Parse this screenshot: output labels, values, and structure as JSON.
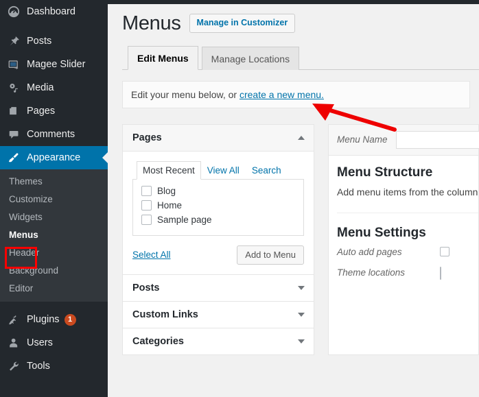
{
  "sidebar": {
    "items": [
      {
        "label": "Dashboard",
        "icon": "dashboard-icon",
        "current": false
      },
      {
        "label": "Posts",
        "icon": "pin-icon",
        "current": false
      },
      {
        "label": "Magee Slider",
        "icon": "slider-icon",
        "current": false
      },
      {
        "label": "Media",
        "icon": "media-icon",
        "current": false
      },
      {
        "label": "Pages",
        "icon": "pages-icon",
        "current": false
      },
      {
        "label": "Comments",
        "icon": "comments-icon",
        "current": false
      },
      {
        "label": "Appearance",
        "icon": "brush-icon",
        "current": true
      }
    ],
    "submenu": [
      {
        "label": "Themes",
        "active": false
      },
      {
        "label": "Customize",
        "active": false
      },
      {
        "label": "Widgets",
        "active": false
      },
      {
        "label": "Menus",
        "active": true
      },
      {
        "label": "Header",
        "active": false
      },
      {
        "label": "Background",
        "active": false
      },
      {
        "label": "Editor",
        "active": false
      }
    ],
    "bottom_items": [
      {
        "label": "Plugins",
        "icon": "plug-icon",
        "badge": "1"
      },
      {
        "label": "Users",
        "icon": "user-icon",
        "badge": ""
      },
      {
        "label": "Tools",
        "icon": "wrench-icon",
        "badge": ""
      }
    ]
  },
  "header": {
    "title": "Menus",
    "customizer_button": "Manage in Customizer"
  },
  "tabs": [
    {
      "label": "Edit Menus",
      "active": true
    },
    {
      "label": "Manage Locations",
      "active": false
    }
  ],
  "notice": {
    "text_before": "Edit your menu below, or ",
    "link": "create a new menu.",
    "text_after": ""
  },
  "left_column": {
    "panels": [
      {
        "title": "Pages",
        "expanded": true,
        "caret": "caret-up-icon",
        "inner_tabs": [
          {
            "label": "Most Recent",
            "active": true
          },
          {
            "label": "View All",
            "active": false
          },
          {
            "label": "Search",
            "active": false
          }
        ],
        "items": [
          {
            "label": "Blog",
            "checked": false
          },
          {
            "label": "Home",
            "checked": false
          },
          {
            "label": "Sample page",
            "checked": false
          }
        ],
        "select_all": "Select All",
        "add_button": "Add to Menu"
      },
      {
        "title": "Posts",
        "expanded": false,
        "caret": "caret-down-icon"
      },
      {
        "title": "Custom Links",
        "expanded": false,
        "caret": "caret-down-icon"
      },
      {
        "title": "Categories",
        "expanded": false,
        "caret": "caret-down-icon"
      }
    ]
  },
  "right_column": {
    "menu_name_label": "Menu Name",
    "menu_name_value": "",
    "menu_name_placeholder": "",
    "structure_title": "Menu Structure",
    "structure_text": "Add menu items from the column",
    "settings_title": "Menu Settings",
    "auto_add_label": "Auto add pages",
    "theme_locations_label": "Theme locations"
  },
  "annotations": {
    "arrow_color": "#ee0000",
    "highlight_box_color": "#ff0000"
  },
  "colors": {
    "sidebar_bg": "#23282d",
    "submenu_bg": "#32373c",
    "accent": "#0073aa",
    "badge": "#ca4a1f",
    "content_bg": "#f1f1f1"
  }
}
